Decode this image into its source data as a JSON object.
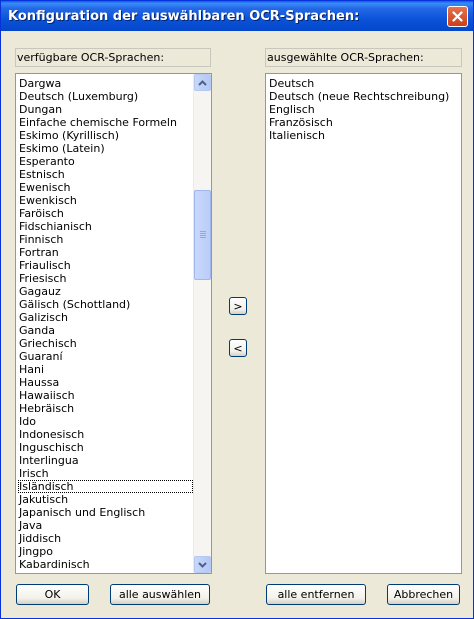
{
  "window": {
    "title": "Konfiguration der auswählbaren OCR-Sprachen:"
  },
  "icons": {
    "close": "close-icon",
    "move_right": "chevron-right-icon",
    "move_left": "chevron-left-icon",
    "scroll_up": "arrow-up-icon",
    "scroll_down": "arrow-down-icon"
  },
  "available": {
    "label": "verfügbare OCR-Sprachen:",
    "items": [
      "Dargwa",
      "Deutsch (Luxemburg)",
      "Dungan",
      "Einfache chemische Formeln",
      "Eskimo (Kyrillisch)",
      "Eskimo (Latein)",
      "Esperanto",
      "Estnisch",
      "Ewenisch",
      "Ewenkisch",
      "Faröisch",
      "Fidschianisch",
      "Finnisch",
      "Fortran",
      "Friaulisch",
      "Friesisch",
      "Gagauz",
      "Gälisch (Schottland)",
      "Galizisch",
      "Ganda",
      "Griechisch",
      "Guaraní",
      "Hani",
      "Haussa",
      "Hawaiisch",
      "Hebräisch",
      "Ido",
      "Indonesisch",
      "Inguschisch",
      "Interlingua",
      "Irisch",
      "Isländisch",
      "Jakutisch",
      "Japanisch und Englisch",
      "Java",
      "Jiddisch",
      "Jingpo",
      "Kabardinisch"
    ],
    "focused_item": "Isländisch"
  },
  "selected": {
    "label": "ausgewählte OCR-Sprachen:",
    "items": [
      "Deutsch",
      "Deutsch (neue Rechtschreibung)",
      "Englisch",
      "Französisch",
      "Italienisch"
    ]
  },
  "buttons": {
    "ok": "OK",
    "select_all": "alle auswählen",
    "remove_all": "alle entfernen",
    "cancel": "Abbrechen",
    "move_right": ">",
    "move_left": "<"
  },
  "colors": {
    "titlebar": "#0a53d9",
    "dialog_bg": "#ece9d8",
    "list_border": "#7f9db9",
    "close_button": "#cc3e1a"
  }
}
